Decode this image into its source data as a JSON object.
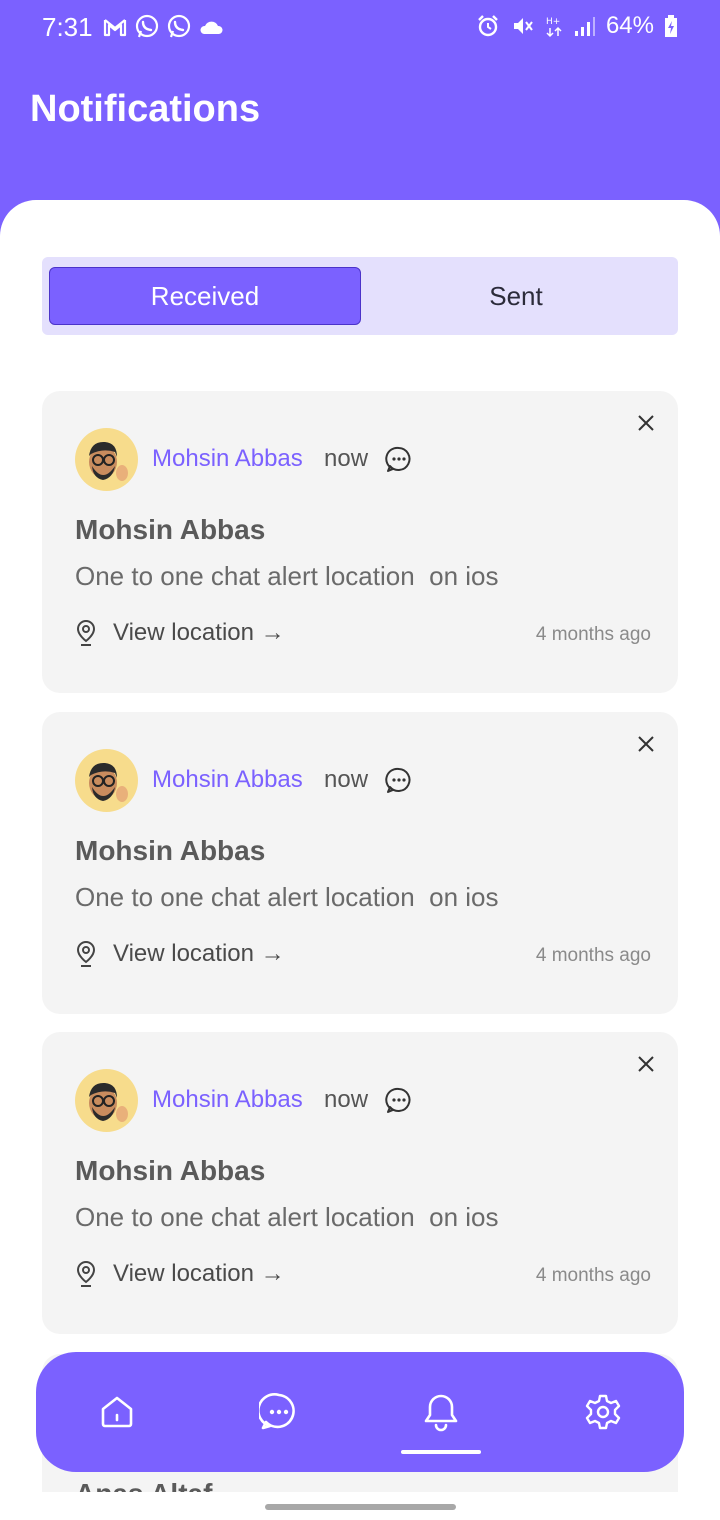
{
  "status_bar": {
    "time": "7:31",
    "battery": "64%",
    "left_icons": [
      "gmail-icon",
      "whatsapp-icon",
      "whatsapp-business-icon",
      "cloud-icon"
    ],
    "right_icons": [
      "alarm-icon",
      "mute-icon",
      "network-h-plus-icon",
      "signal-icon",
      "battery-icon"
    ]
  },
  "header": {
    "title": "Notifications"
  },
  "tabs": [
    {
      "label": "Received",
      "active": true
    },
    {
      "label": "Sent",
      "active": false
    }
  ],
  "notifications": [
    {
      "sender": "Mohsin Abbas",
      "time": "now",
      "title": "Mohsin Abbas",
      "message": "One to one chat alert location  on ios",
      "action_label": "View location →",
      "ago": "4 months ago"
    },
    {
      "sender": "Mohsin Abbas",
      "time": "now",
      "title": "Mohsin Abbas",
      "message": "One to one chat alert location  on ios",
      "action_label": "View location →",
      "ago": "4 months ago"
    },
    {
      "sender": "Mohsin Abbas",
      "time": "now",
      "title": "Mohsin Abbas",
      "message": "One to one chat alert location  on ios",
      "action_label": "View location →",
      "ago": "4 months ago"
    }
  ],
  "partial_notification": {
    "title": "Anas Altaf"
  },
  "bottom_nav": {
    "items": [
      {
        "icon": "home-icon",
        "active": false
      },
      {
        "icon": "chat-icon",
        "active": false
      },
      {
        "icon": "bell-icon",
        "active": true
      },
      {
        "icon": "gear-icon",
        "active": false
      }
    ]
  },
  "colors": {
    "accent": "#7B61FF",
    "tab_background": "#E4E0FD",
    "card_background": "#F4F4F4",
    "avatar_background": "#F7DC8C"
  }
}
